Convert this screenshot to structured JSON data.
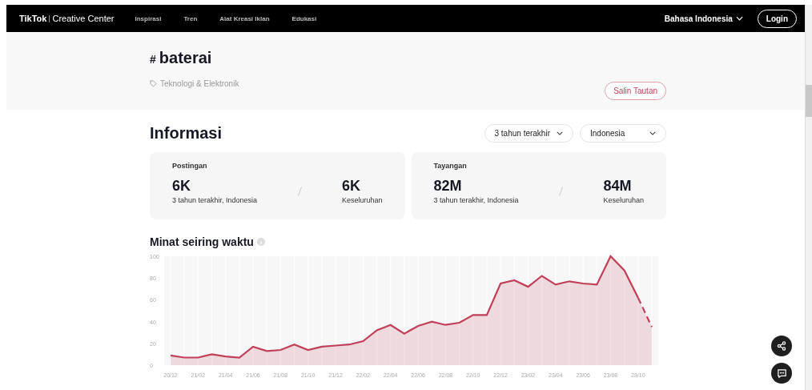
{
  "nav": {
    "logo_brand": "TikTok",
    "logo_sub": "Creative Center",
    "links": [
      "Inspirasi",
      "Tren",
      "Alat Kreasi Iklan",
      "Edukasi"
    ],
    "language": "Bahasa Indonesia",
    "login": "Login"
  },
  "hashtag": {
    "symbol": "#",
    "name": "baterai",
    "category": "Teknologi & Elektronik",
    "copy_button": "Salin Tautan"
  },
  "info": {
    "title": "Informasi",
    "filters": [
      {
        "label": "3 tahun terakhir"
      },
      {
        "label": "Indonesia"
      }
    ],
    "cards": [
      {
        "title": "Postingan",
        "primary_value": "6K",
        "primary_caption": "3 tahun terakhir, Indonesia",
        "total_value": "6K",
        "total_caption": "Keseluruhan"
      },
      {
        "title": "Tayangan",
        "primary_value": "82M",
        "primary_caption": "3 tahun terakhir, Indonesia",
        "total_value": "84M",
        "total_caption": "Keseluruhan"
      }
    ]
  },
  "interest": {
    "title": "Minat seiring waktu",
    "chart_data": {
      "type": "area",
      "categories": [
        "20/12",
        null,
        "21/02",
        null,
        "21/04",
        null,
        "21/06",
        null,
        "21/08",
        null,
        "21/10",
        null,
        "21/12",
        null,
        "22/02",
        null,
        "22/04",
        null,
        "22/06",
        null,
        "22/08",
        null,
        "22/10",
        null,
        "22/12",
        null,
        "23/02",
        null,
        "23/04",
        null,
        "23/06",
        null,
        "23/08",
        null,
        "23/10",
        null
      ],
      "grid": true,
      "series": [
        {
          "color": "#c0405a",
          "values": [
            9,
            7,
            7,
            10,
            8,
            7,
            17,
            13,
            14,
            19,
            14,
            17,
            18,
            19,
            22,
            32,
            37,
            29,
            36,
            40,
            37,
            39,
            46,
            46,
            75,
            78,
            72,
            82,
            74,
            77,
            75,
            74,
            100,
            87,
            62,
            35
          ]
        }
      ],
      "ylim": [
        0,
        100
      ],
      "yticks": [
        0,
        20,
        40,
        60,
        80,
        100
      ]
    }
  }
}
